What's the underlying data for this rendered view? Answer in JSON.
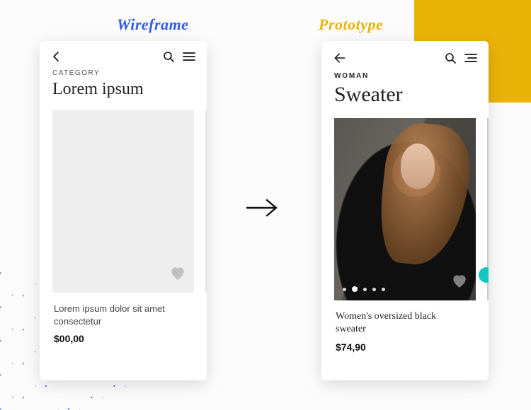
{
  "labels": {
    "wireframe": "Wireframe",
    "prototype": "Prototype"
  },
  "wireframe": {
    "kicker": "CATEGORY",
    "title": "Lorem ipsum",
    "card": {
      "description": "Lorem ipsum dolor sit amet consectetur",
      "price": "$00,00"
    }
  },
  "prototype": {
    "kicker": "WOMAN",
    "title": "Sweater",
    "card": {
      "description": "Women's oversized black sweater",
      "price": "$74,90",
      "active_slide_index": 1,
      "slide_count": 5
    },
    "accent_color": "#14c6c0"
  },
  "icons": {
    "back_chevron": "back-chevron-icon",
    "back_arrow": "back-arrow-icon",
    "search": "search-icon",
    "menu": "menu-icon",
    "heart": "heart-icon",
    "transition_arrow": "arrow-right-icon"
  }
}
